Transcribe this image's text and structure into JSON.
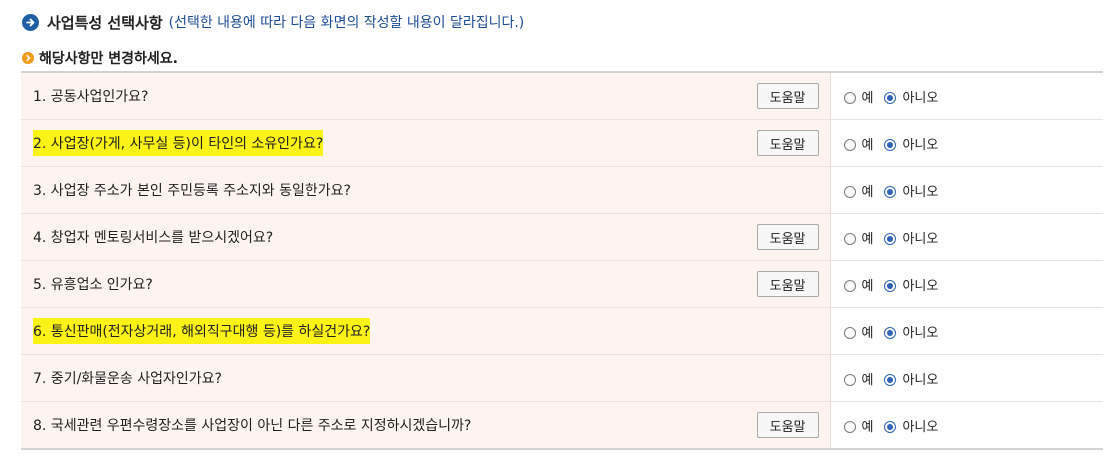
{
  "section": {
    "title": "사업특성 선택사항",
    "description": "(선택한 내용에 따라 다음 화면의 작성할 내용이 달라집니다.)",
    "subtitle": "해당사항만 변경하세요."
  },
  "options": {
    "yes": "예",
    "no": "아니오"
  },
  "help_label": "도움말",
  "accent_colors": {
    "highlight": "#fbf316",
    "radio_selected": "#2e63b8",
    "title_icon": "#1f5fa6",
    "sub_icon": "#f29a1a"
  },
  "questions": [
    {
      "text": "1. 공동사업인가요?",
      "has_help": true,
      "highlighted": false,
      "selected": "아니오"
    },
    {
      "text": "2. 사업장(가게, 사무실 등)이 타인의 소유인가요?",
      "has_help": true,
      "highlighted": true,
      "selected": "아니오"
    },
    {
      "text": "3. 사업장 주소가 본인 주민등록 주소지와 동일한가요?",
      "has_help": false,
      "highlighted": false,
      "selected": "아니오"
    },
    {
      "text": "4. 창업자 멘토링서비스를 받으시겠어요?",
      "has_help": true,
      "highlighted": false,
      "selected": "아니오"
    },
    {
      "text": "5. 유흥업소 인가요?",
      "has_help": true,
      "highlighted": false,
      "selected": "아니오"
    },
    {
      "text": "6. 통신판매(전자상거래, 해외직구대행 등)를 하실건가요?",
      "has_help": false,
      "highlighted": true,
      "selected": "아니오"
    },
    {
      "text": "7. 중기/화물운송 사업자인가요?",
      "has_help": false,
      "highlighted": false,
      "selected": "아니오"
    },
    {
      "text": "8. 국세관련 우편수령장소를 사업장이 아닌 다른 주소로 지정하시겠습니까?",
      "has_help": true,
      "highlighted": false,
      "selected": "아니오"
    }
  ]
}
